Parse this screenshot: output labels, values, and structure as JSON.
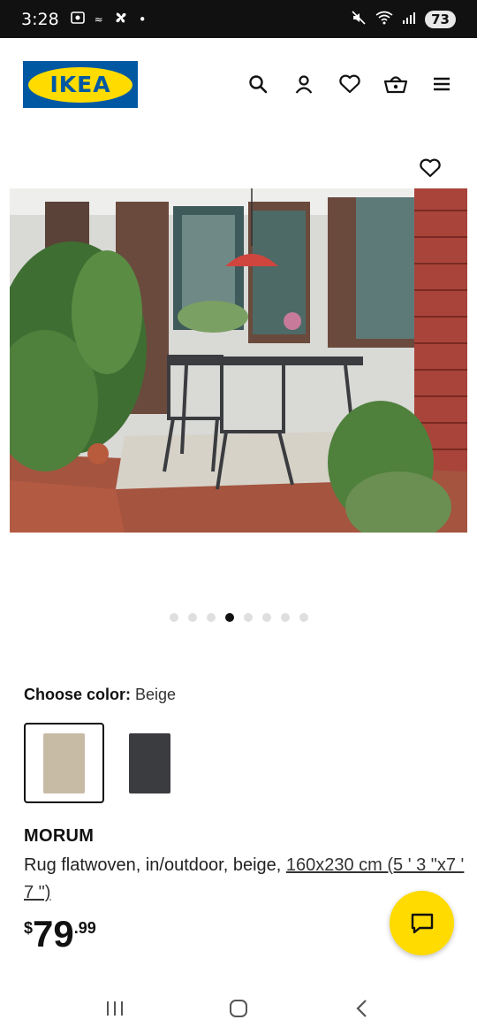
{
  "status_bar": {
    "time": "3:28",
    "battery": "73"
  },
  "brand": {
    "logo_text": "IKEA",
    "blue": "#0058a3",
    "yellow": "#ffdb00"
  },
  "header_icons": [
    "search-icon",
    "account-icon",
    "heart-icon",
    "basket-icon",
    "menu-icon"
  ],
  "carousel": {
    "total": 8,
    "active_index": 3
  },
  "color_picker": {
    "label": "Choose color:",
    "selected": "Beige",
    "swatches": [
      {
        "color": "#c8bba6",
        "selected": true
      },
      {
        "color": "#3a3c3f",
        "selected": false
      }
    ]
  },
  "product": {
    "name": "MORUM",
    "description": "Rug flatwoven, in/outdoor, beige, ",
    "size_link": "160x230 cm (5 ' 3 \"x7 ' 7 \")",
    "price_currency": "$",
    "price_int": "79",
    "price_dec": ".99"
  }
}
